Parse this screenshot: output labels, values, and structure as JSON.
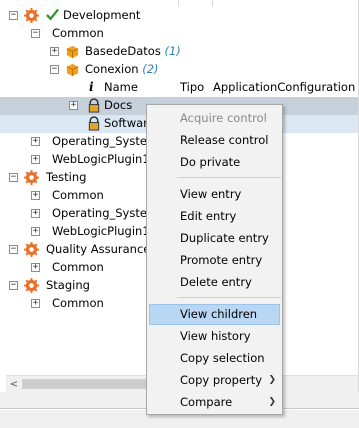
{
  "tree": {
    "development": {
      "label": "Development",
      "common": "Common"
    },
    "basededatos": {
      "label": "BasedeDatos",
      "count": "(1)"
    },
    "conexion": {
      "label": "Conexion",
      "count": "(2)"
    },
    "header": {
      "name": "Name",
      "tipo": "Tipo",
      "appconfig": "ApplicationConfiguration"
    },
    "docs": {
      "label": "Docs"
    },
    "software": {
      "label": "Softwar"
    },
    "dev_items": [
      "Operating_System",
      "WebLogicPlugin1"
    ],
    "testing": {
      "label": "Testing",
      "items": [
        "Common",
        "Operating_System",
        "WebLogicPlugin1"
      ]
    },
    "qa": {
      "label": "Quality Assurance",
      "items": [
        "Common"
      ]
    },
    "staging": {
      "label": "Staging",
      "items": [
        "Common"
      ]
    }
  },
  "context_menu": {
    "acquire_control": "Acquire control",
    "release_control": "Release control",
    "do_private": "Do private",
    "view_entry": "View entry",
    "edit_entry": "Edit entry",
    "duplicate_entry": "Duplicate entry",
    "promote_entry": "Promote entry",
    "delete_entry": "Delete entry",
    "view_children": "View children",
    "view_history": "View history",
    "copy_selection": "Copy selection",
    "copy_property": "Copy property",
    "compare": "Compare"
  },
  "colors": {
    "gear": "#e8702a",
    "check": "#2e9a2e",
    "box": "#f0a020",
    "count": "#2f7fc1",
    "selection": "#c6d0da",
    "menu_active": "#b9d6f2"
  }
}
